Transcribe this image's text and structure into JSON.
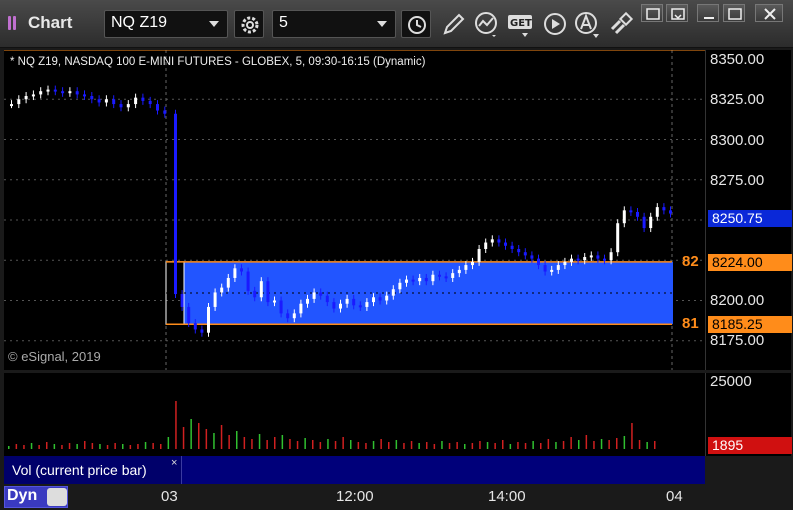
{
  "window": {
    "title": "Chart",
    "symbol": "NQ Z19",
    "interval": "5"
  },
  "chart": {
    "header": "* NQ Z19, NASDAQ 100 E-MINI FUTURES - GLOBEX, 5, 09:30-16:15 (Dynamic)",
    "copyright": "© eSignal, 2019",
    "price_ticks": [
      "8350.00",
      "8325.00",
      "8300.00",
      "8275.00",
      "8200.00",
      "8175.00"
    ],
    "last_price": "8250.75",
    "level_high": {
      "label": "82",
      "price": "8224.00"
    },
    "level_low": {
      "label": "81",
      "price": "8185.25"
    },
    "colors": {
      "up": "#ffffff",
      "down": "#1a1aff",
      "box": "#2255ff",
      "level": "#ff8c1a",
      "vol_up": "#30c030",
      "vol_down": "#d02020"
    }
  },
  "volume": {
    "tick": "25000",
    "current": "1895",
    "study_label": "Vol (current price bar)",
    "close_label": "×"
  },
  "time_axis": {
    "ticks": [
      "03",
      "12:00",
      "14:00",
      "04"
    ],
    "dyn_label": "Dyn"
  }
}
